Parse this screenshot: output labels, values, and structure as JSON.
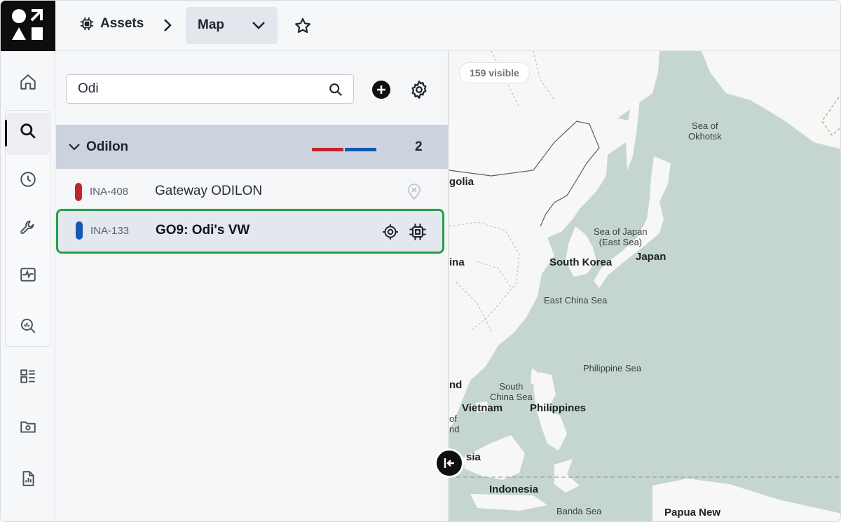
{
  "breadcrumb": {
    "section": "Assets",
    "view": "Map"
  },
  "search": {
    "value": "Odi"
  },
  "group": {
    "name": "Odilon",
    "count": "2"
  },
  "rows": [
    {
      "code": "INA-408",
      "name": "Gateway ODILON",
      "color": "#c0272d"
    },
    {
      "code": "INA-133",
      "name": "GO9: Odi's VW",
      "color": "#1558b0"
    }
  ],
  "map": {
    "visible_count": "159 visible",
    "labels": {
      "okhotsk": "Sea of\nOkhotsk",
      "mongolia": "golia",
      "japan_sea": "Sea of Japan\n(East Sea)",
      "japan": "Japan",
      "china": "ina",
      "south_korea": "South Korea",
      "east_china_sea": "East China Sea",
      "philippine_sea": "Philippine Sea",
      "nd1": "nd",
      "south_china_sea": "South\nChina Sea",
      "vietnam": "Vietnam",
      "philippines": "Philippines",
      "nd2": "of\nnd",
      "sia": "sia",
      "indonesia": "Indonesia",
      "banda_sea": "Banda Sea",
      "papua": "Papua New"
    }
  },
  "colors": {
    "accent_selected": "#22a04a",
    "group_header": "#ccd3df",
    "water": "#c5d6d0",
    "land": "#f7f7f5"
  }
}
